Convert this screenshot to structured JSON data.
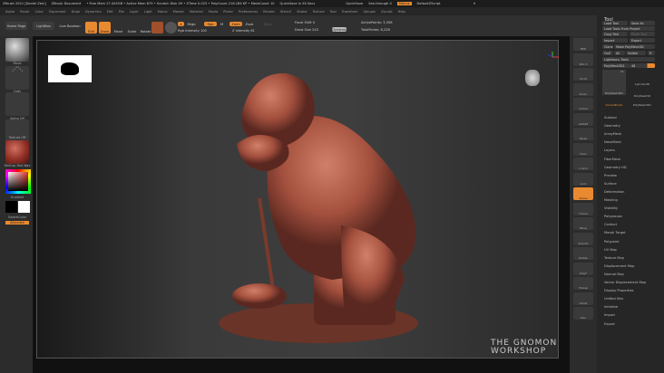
{
  "titlebar": {
    "app": "ZBrush 2021 [Daniel Zeni]",
    "doc": "ZBrush Document",
    "stats": "• Free Mem 27.445GB • Active Mem 879 • Scratch Disk 49 • ZTime 0.023 • PolyCount 218.184 KP • MeshCount 10",
    "quicksave": "QuickSave In 56 Secs",
    "quicksave_btn": "QuickSave",
    "see_through": "See-through 0",
    "menus_btn": "Menus",
    "script": "DefaultZScript"
  },
  "menu": [
    "Alpha",
    "Brush",
    "Color",
    "Document",
    "Draw",
    "Dynamics",
    "Edit",
    "File",
    "Layer",
    "Light",
    "Macro",
    "Marker",
    "Material",
    "Movie",
    "Picker",
    "Preferences",
    "Render",
    "Stencil",
    "Stroke",
    "Texture",
    "Tool",
    "Transform",
    "Zplugin",
    "Zscript",
    "Help"
  ],
  "toolbar": {
    "home": "Home Page",
    "lightbox": "LightBox",
    "live_boolean": "Live Boolean",
    "edit": "Edit",
    "draw": "Draw",
    "move": "Move",
    "scale": "Scale",
    "rotate": "Rotate",
    "a": "A",
    "mrgb": "Mrgb",
    "rgb": "Rgb",
    "m": "M",
    "zadd": "Zadd",
    "zsub": "Zsub",
    "zcut": "Zcut",
    "rgb_intensity": "Rgb Intensity 100",
    "z_intensity": "Z Intensity 61",
    "focal_shift": "Focal Shift 0",
    "draw_size": "Draw Size 243",
    "dynamic": "Dynamic",
    "active_points": "ActivePoints: 3,356",
    "total_points": "TotalPoints: 8,228"
  },
  "left_shelf": {
    "brush": "Move",
    "stroke": "Dots",
    "alpha": "Alpha Off",
    "texture": "Texture Off",
    "material": "MatCap Red Wax",
    "gradient": "Gradient",
    "switch": "SwitchColor",
    "alternate": "Alternate",
    "accent": "#e98a30"
  },
  "right_shelf": [
    "BPR",
    "SPix 3",
    "Scroll",
    "Zoom",
    "Actual",
    "AAHalf",
    "Persp",
    "Floor",
    "L.Sym",
    "Lock",
    "Xpose",
    "Frame",
    "Move",
    "ZoomD",
    "Rotate",
    "PolyF",
    "Transp",
    "Ghost",
    "Solo"
  ],
  "tool_panel": {
    "title": "Tool",
    "load_tool": "Load Tool",
    "save_as": "Save As",
    "load_project": "Load Tools From Project",
    "copy_tool": "Copy Tool",
    "paste_tool": "Paste Tool",
    "import": "Import",
    "export": "Export",
    "clone": "Clone",
    "make_polymesh": "Make PolyMesh3D",
    "goz": "GoZ",
    "all": "All",
    "visible": "Visible",
    "r": "R",
    "lightbox_tools": "Lightbox ▸ Tools",
    "current": "PolyMesh3D1",
    "current_val": "48",
    "thumbs": [
      "PolyMesh3D1",
      "Cylinder3D",
      "PolyMesh3D",
      "SimpleBrush",
      "PolyMesh3D1"
    ],
    "count": "11",
    "sections": [
      "Subtool",
      "Geometry",
      "ArrayMesh",
      "NanoMesh",
      "Layers",
      "FiberMesh",
      "Geometry HD",
      "Preview",
      "Surface",
      "Deformation",
      "Masking",
      "Visibility",
      "Polygroups",
      "Contact",
      "Morph Target",
      "Polypaint",
      "UV Map",
      "Texture Map",
      "Displacement Map",
      "Normal Map",
      "Vector Displacement Map",
      "Display Properties",
      "Unified Skin",
      "Initialize",
      "Import",
      "Export"
    ]
  },
  "watermark": "THE GNOMON WORKSHOP"
}
